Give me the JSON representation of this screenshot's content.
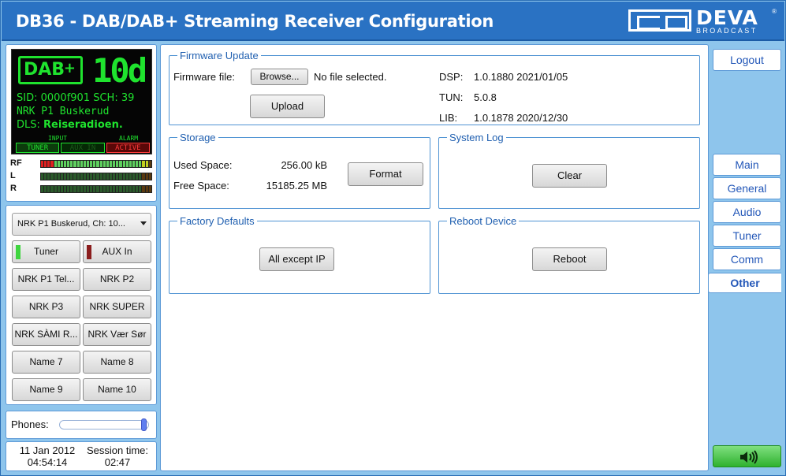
{
  "header": {
    "title": "DB36 - DAB/DAB+ Streaming Receiver Configuration",
    "logo_word": "DEVA",
    "logo_sub": "BROADCAST",
    "logo_reg": "®"
  },
  "display": {
    "dab_label": "DAB",
    "dab_plus": "+",
    "channel": "10d",
    "sid_line": "SID: 0000f901   SCH: 39",
    "station": "NRK P1 Buskerud",
    "dls_label": "DLS:",
    "dls_text": "Reiseradioen.",
    "input_label": "INPUT",
    "alarm_label": "ALARM",
    "indicators": [
      "TUNER",
      "AUX IN",
      "ACTIVE"
    ]
  },
  "meters": {
    "labels": [
      "RF",
      "L",
      "R"
    ],
    "rf_level": 0.95,
    "l_level": 0.0,
    "r_level": 0.0
  },
  "presets": {
    "selected": "NRK P1 Buskerud, Ch: 10...",
    "source_buttons": [
      "Tuner",
      "AUX In"
    ],
    "buttons": [
      "NRK P1 Tel...",
      "NRK P2",
      "NRK P3",
      "NRK SUPER",
      "NRK SÀMI R...",
      "NRK Vær Sør",
      "Name 7",
      "Name 8",
      "Name 9",
      "Name 10"
    ]
  },
  "phones": {
    "label": "Phones:",
    "level": 1.0
  },
  "time": {
    "date": "11 Jan 2012",
    "clock": "04:54:14",
    "session_label": "Session time:",
    "session_value": "02:47"
  },
  "firmware": {
    "legend": "Firmware Update",
    "file_label": "Firmware file:",
    "browse_label": "Browse...",
    "no_file": "No file selected.",
    "upload_label": "Upload",
    "versions": [
      {
        "key": "DSP:",
        "value": "1.0.1880 2021/01/05"
      },
      {
        "key": "TUN:",
        "value": "5.0.8"
      },
      {
        "key": "LIB:",
        "value": "1.0.1878 2020/12/30"
      }
    ]
  },
  "storage": {
    "legend": "Storage",
    "used_label": "Used Space:",
    "used_value": "256.00 kB",
    "free_label": "Free Space:",
    "free_value": "15185.25 MB",
    "format_label": "Format"
  },
  "system_log": {
    "legend": "System Log",
    "clear_label": "Clear"
  },
  "factory": {
    "legend": "Factory Defaults",
    "button_label": "All except IP"
  },
  "reboot": {
    "legend": "Reboot Device",
    "button_label": "Reboot"
  },
  "nav": {
    "logout": "Logout",
    "items": [
      "Main",
      "General",
      "Audio",
      "Tuner",
      "Comm",
      "Other"
    ],
    "active": "Other"
  },
  "colors": {
    "header": "#2a72c3",
    "background": "#8ec5ec",
    "lcd_green": "#1fe32e",
    "accent": "#1f5fb0"
  }
}
